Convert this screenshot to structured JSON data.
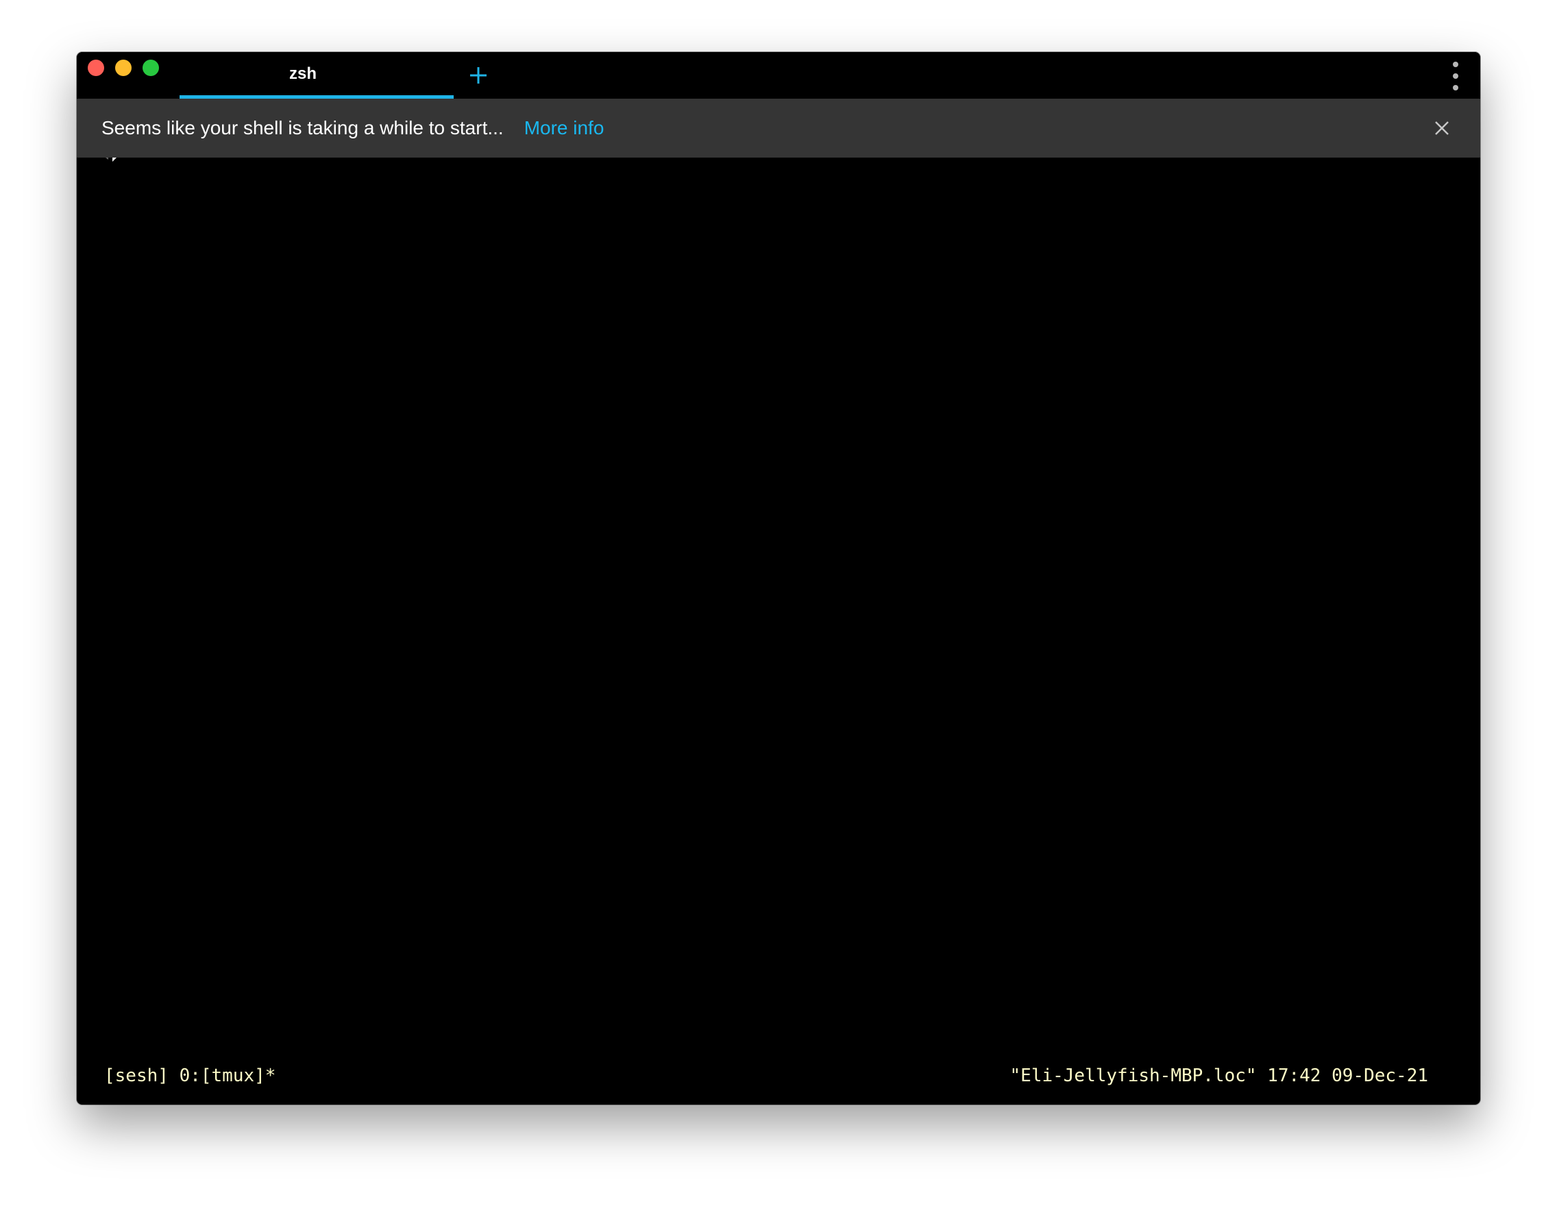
{
  "window": {
    "tabs": [
      {
        "label": "zsh",
        "active": true
      }
    ],
    "new_tab_icon": "plus-icon",
    "menu_icon": "vertical-ellipsis-icon"
  },
  "banner": {
    "message": "Seems like your shell is taking a while to start...",
    "link_label": "More info",
    "close_icon": "close-icon"
  },
  "statusbar": {
    "left": "[sesh] 0:[tmux]*",
    "right": "\"Eli-Jellyfish-MBP.loc\" 17:42 09-Dec-21"
  },
  "colors": {
    "accent": "#1fb3e6",
    "link": "#1ab8f0",
    "banner_bg": "#353535",
    "terminal_bg": "#000000",
    "status_text": "#fefcc8",
    "traffic_close": "#ff5f57",
    "traffic_minimize": "#febc2e",
    "traffic_maximize": "#28c840"
  }
}
